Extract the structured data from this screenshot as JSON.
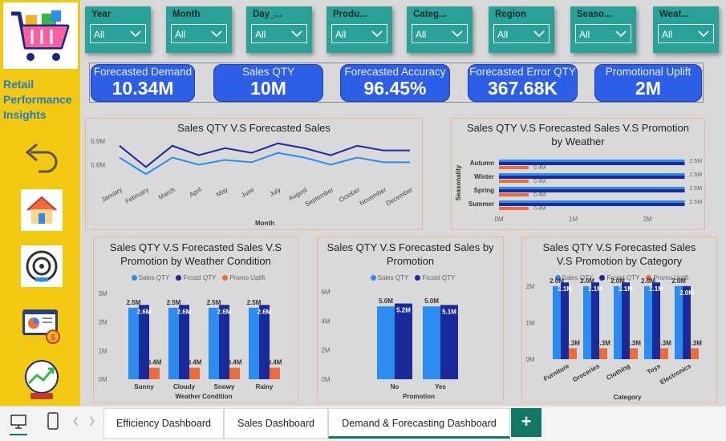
{
  "brand": {
    "title": "Retail Performance Insights"
  },
  "sidebar": {
    "icons": [
      "shopping-cart-logo-icon",
      "back-arrow-icon",
      "home-icon",
      "target-icon",
      "dashboard-report-icon",
      "growth-globe-icon"
    ]
  },
  "slicers": [
    {
      "label": "Year",
      "value": "All"
    },
    {
      "label": "Month",
      "value": "All"
    },
    {
      "label": "Day_...",
      "value": "All"
    },
    {
      "label": "Produ...",
      "value": "All"
    },
    {
      "label": "Categ...",
      "value": "All"
    },
    {
      "label": "Region",
      "value": "All"
    },
    {
      "label": "Seaso...",
      "value": "All"
    },
    {
      "label": "Weat...",
      "value": "All"
    }
  ],
  "kpis": [
    {
      "title": "Forecasted Demand",
      "value": "10.34M"
    },
    {
      "title": "Sales QTY",
      "value": "10M"
    },
    {
      "title": "Forecasted Accuracy",
      "value": "96.45%"
    },
    {
      "title": "Forecasted Error QTY",
      "value": "367.68K"
    },
    {
      "title": "Promotional Uplift",
      "value": "2M"
    }
  ],
  "colors": {
    "sales": "#2b8cf0",
    "forecast": "#1a2a9b",
    "promo": "#ee6b3b",
    "kpi": "#2c5ee8",
    "slicer": "#2aa198",
    "sidebar": "#f2c811",
    "tab_accent": "#117865"
  },
  "legend": {
    "sales": "Sales QTY",
    "forecast": "Frcstd QTY",
    "promo": "Promo Uplift"
  },
  "chart_data": [
    {
      "type": "line",
      "title": "Sales QTY V.S Forecasted Sales",
      "xlabel": "Month",
      "ylabel": "",
      "x": [
        "January",
        "February",
        "March",
        "April",
        "May",
        "June",
        "July",
        "August",
        "September",
        "October",
        "November",
        "December"
      ],
      "y_ticks": [
        "0.8M",
        "0.9M"
      ],
      "ylim": [
        0.73,
        0.92
      ],
      "series": [
        {
          "name": "Sales QTY",
          "values": [
            0.83,
            0.76,
            0.83,
            0.8,
            0.82,
            0.81,
            0.85,
            0.83,
            0.8,
            0.83,
            0.81,
            0.81
          ]
        },
        {
          "name": "Frcstd QTY",
          "values": [
            0.88,
            0.79,
            0.88,
            0.84,
            0.87,
            0.85,
            0.89,
            0.87,
            0.84,
            0.88,
            0.86,
            0.86
          ]
        }
      ]
    },
    {
      "type": "bar",
      "orientation": "horizontal",
      "title": "Sales QTY V.S Forecasted Sales V.S Promotion by Weather",
      "ylabel": "Seasonality",
      "categories": [
        "Autumn",
        "Winter",
        "Spring",
        "Summer"
      ],
      "x_ticks": [
        "0M",
        "1M",
        "2M"
      ],
      "xlim": [
        0,
        2.7
      ],
      "series": [
        {
          "name": "Sales QTY",
          "values": [
            2.5,
            2.5,
            2.5,
            2.5
          ],
          "labels": [
            "2.5M",
            "2.5M",
            "2.5M",
            "2.5M"
          ]
        },
        {
          "name": "Frcstd QTY",
          "values": [
            2.5,
            2.5,
            2.5,
            2.5
          ],
          "labels": [
            "",
            "",
            "",
            ""
          ]
        },
        {
          "name": "Promo Uplift",
          "values": [
            0.4,
            0.4,
            0.4,
            0.4
          ],
          "labels": [
            "0.4M",
            "0.4M",
            "0.4M",
            "0.4M"
          ]
        }
      ]
    },
    {
      "type": "bar",
      "title": "Sales QTY V.S Forecasted Sales V.S Promotion by Weather Condition",
      "xlabel": "Weather Condition",
      "categories": [
        "Sunny",
        "Cloudy",
        "Snowy",
        "Rainy"
      ],
      "y_ticks": [
        "0M",
        "1M",
        "2M",
        "3M"
      ],
      "ylim": [
        0,
        3
      ],
      "series": [
        {
          "name": "Sales QTY",
          "values": [
            2.5,
            2.5,
            2.5,
            2.5
          ],
          "labels": [
            "2.5M",
            "2.5M",
            "2.5M",
            "2.5M"
          ]
        },
        {
          "name": "Frcstd QTY",
          "values": [
            2.6,
            2.6,
            2.6,
            2.6
          ],
          "labels": [
            "2.6M",
            "2.6M",
            "2.6M",
            "2.6M"
          ]
        },
        {
          "name": "Promo Uplift",
          "values": [
            0.4,
            0.4,
            0.4,
            0.4
          ],
          "labels": [
            "0.4M",
            "0.4M",
            "0.4M",
            "0.4M"
          ]
        }
      ]
    },
    {
      "type": "bar",
      "title": "Sales QTY V.S Forecasted Sales by Promotion",
      "xlabel": "Promotion",
      "categories": [
        "No",
        "Yes"
      ],
      "y_ticks": [
        "0M",
        "2M",
        "4M",
        "6M"
      ],
      "ylim": [
        0,
        6
      ],
      "series": [
        {
          "name": "Sales QTY",
          "values": [
            5.0,
            5.0
          ],
          "labels": [
            "5.0M",
            "5.0M"
          ]
        },
        {
          "name": "Frcstd QTY",
          "values": [
            5.2,
            5.1
          ],
          "labels": [
            "5.2M",
            "5.1M"
          ]
        }
      ]
    },
    {
      "type": "bar",
      "title": "Sales QTY V.S Forecasted Sales V.S Promotion by Category",
      "xlabel": "Category",
      "categories": [
        "Furniture",
        "Groceries",
        "Clothing",
        "Toys",
        "Electronics"
      ],
      "y_ticks": [
        "0M",
        "1M",
        "2M"
      ],
      "ylim": [
        0,
        2.5
      ],
      "series": [
        {
          "name": "Sales QTY",
          "values": [
            2.0,
            2.0,
            2.0,
            2.0,
            2.0
          ],
          "labels": [
            "2.0M",
            "2.0M",
            "2.0M",
            "2.0M",
            "2.0M"
          ]
        },
        {
          "name": "Frcstd QTY",
          "values": [
            2.1,
            2.1,
            2.1,
            2.1,
            2.0
          ],
          "labels": [
            "2.1M",
            "2.1M",
            "2.1M",
            "2.1M",
            "2.0M"
          ]
        },
        {
          "name": "Promo Uplift",
          "values": [
            0.3,
            0.3,
            0.3,
            0.3,
            0.3
          ],
          "labels": [
            "0.3M",
            "0.3M",
            "0.3M",
            "0.3M",
            "0.3M"
          ]
        }
      ]
    }
  ],
  "tabs": [
    {
      "label": "Efficiency Dashboard",
      "active": false
    },
    {
      "label": "Sales Dashboard",
      "active": false
    },
    {
      "label": "Demand & Forecasting Dashboard",
      "active": true
    }
  ],
  "add_tab": "+"
}
